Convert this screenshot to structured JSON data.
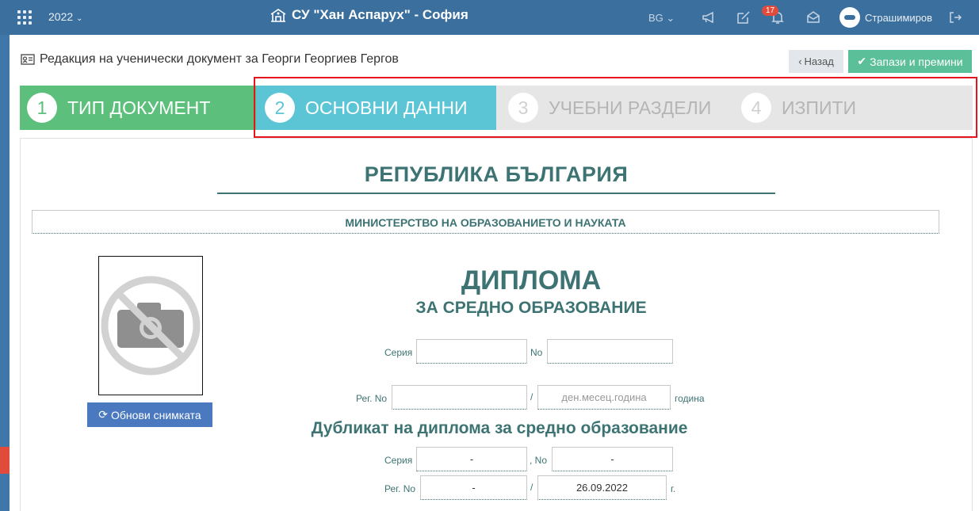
{
  "topbar": {
    "year": "2022",
    "school": "СУ \"Хан Аспарух\" - София",
    "lang": "BG",
    "notifications_count": "17",
    "username": "Страшимиров"
  },
  "header": {
    "title": "Редакция на ученически документ за Георги Георгиев Гергов",
    "back_label": "Назад",
    "save_label": "Запази и премини"
  },
  "steps": [
    {
      "num": "1",
      "label": "ТИП ДОКУМЕНТ"
    },
    {
      "num": "2",
      "label": "ОСНОВНИ ДАННИ"
    },
    {
      "num": "3",
      "label": "УЧЕБНИ РАЗДЕЛИ"
    },
    {
      "num": "4",
      "label": "ИЗПИТИ"
    }
  ],
  "document": {
    "republic": "РЕПУБЛИКА БЪЛГАРИЯ",
    "ministry": "МИНИСТЕРСТВО НА ОБРАЗОВАНИЕТО И НАУКАТА",
    "photo_button": "Обнови снимката",
    "diploma_title": "ДИПЛОМА",
    "diploma_subtitle": "ЗА СРЕДНО ОБРАЗОВАНИЕ",
    "series_label": "Серия",
    "no_label": "No",
    "series_value": "",
    "no_value": "",
    "reg_label": "Рег. No",
    "reg_value": "",
    "slash": "/",
    "date_placeholder": "ден.месец.година",
    "year_label": "година",
    "duplicate_title": "Дубликат на диплома за средно образование",
    "dup_series_label": "Серия",
    "dup_no_label": ", No",
    "dup_series_value": "-",
    "dup_no_value": "-",
    "dup_reg_label": "Рег. No",
    "dup_reg_value": "-",
    "dup_date_value": "26.09.2022",
    "dup_year_label": "г."
  }
}
